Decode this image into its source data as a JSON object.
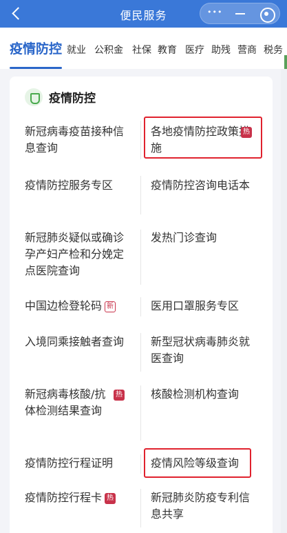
{
  "header": {
    "title": "便民服务"
  },
  "tabs": [
    {
      "label": "疫情防控",
      "active": true
    },
    {
      "label": "就业"
    },
    {
      "label": "公积金"
    },
    {
      "label": "社保"
    },
    {
      "label": "教育"
    },
    {
      "label": "医疗"
    },
    {
      "label": "助残"
    },
    {
      "label": "营商"
    },
    {
      "label": "税务"
    }
  ],
  "card": {
    "title": "疫情防控",
    "items": [
      {
        "label": "新冠病毒疫苗接种信息查询"
      },
      {
        "label": "各地疫情防控政策措施",
        "tag": "热"
      },
      {
        "label": "疫情防控服务专区"
      },
      {
        "label": "疫情防控咨询电话本"
      },
      {
        "label": "新冠肺炎疑似或确诊孕产妇产检和分娩定点医院查询"
      },
      {
        "label": "发热门诊查询"
      },
      {
        "label": "中国边检登轮码",
        "tag": "新"
      },
      {
        "label": "医用口罩服务专区"
      },
      {
        "label": "入境同乘接触者查询"
      },
      {
        "label": "新型冠状病毒肺炎就医查询"
      },
      {
        "label": "新冠病毒核酸/抗体检测结果查询",
        "tag": "热"
      },
      {
        "label": "核酸检测机构查询"
      },
      {
        "label": "疫情防控行程证明"
      },
      {
        "label": "疫情风险等级查询"
      },
      {
        "label": "疫情防控行程卡",
        "tag": "热"
      },
      {
        "label": "新冠肺炎防疫专利信息共享"
      }
    ]
  },
  "colors": {
    "header": "#3a78d8",
    "accent": "#2a66c9",
    "hot": "#c8324a",
    "highlight": "#e0212d"
  }
}
